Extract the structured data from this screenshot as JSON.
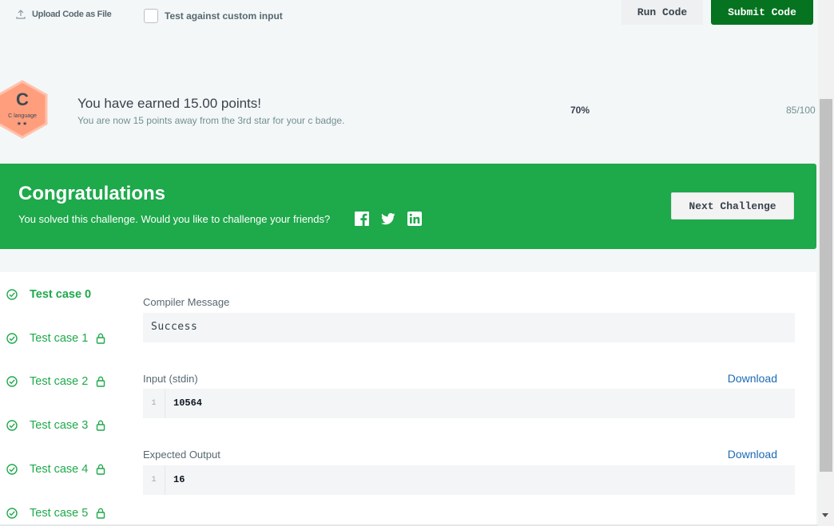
{
  "toolbar": {
    "upload_label": "Upload Code as File",
    "custom_input_label": "Test against custom input",
    "custom_input_checked": false,
    "run_label": "Run Code",
    "submit_label": "Submit Code"
  },
  "badge": {
    "letter": "C",
    "name": "C language",
    "stars": "★★",
    "color": "#ff9e7d"
  },
  "points": {
    "title": "You have earned 15.00 points!",
    "subtitle": "You are now 15 points away from the 3rd star for your c badge.",
    "percent": "70%",
    "score": "85/100"
  },
  "congrats": {
    "title": "Congratulations",
    "subtitle": "You solved this challenge. Would you like to challenge your friends?",
    "share_icons": [
      "facebook-icon",
      "twitter-icon",
      "linkedin-icon"
    ],
    "next_label": "Next Challenge",
    "color": "#1ea94b"
  },
  "test_cases": [
    {
      "label": "Test case 0",
      "active": true,
      "locked": false
    },
    {
      "label": "Test case 1",
      "active": false,
      "locked": true
    },
    {
      "label": "Test case 2",
      "active": false,
      "locked": true
    },
    {
      "label": "Test case 3",
      "active": false,
      "locked": true
    },
    {
      "label": "Test case 4",
      "active": false,
      "locked": true
    },
    {
      "label": "Test case 5",
      "active": false,
      "locked": true
    }
  ],
  "result": {
    "compiler_label": "Compiler Message",
    "compiler_message": "Success",
    "input_label": "Input (stdin)",
    "input_line_no": "1",
    "input_value": "10564",
    "output_label": "Expected Output",
    "output_line_no": "1",
    "output_value": "16",
    "download_label": "Download"
  }
}
